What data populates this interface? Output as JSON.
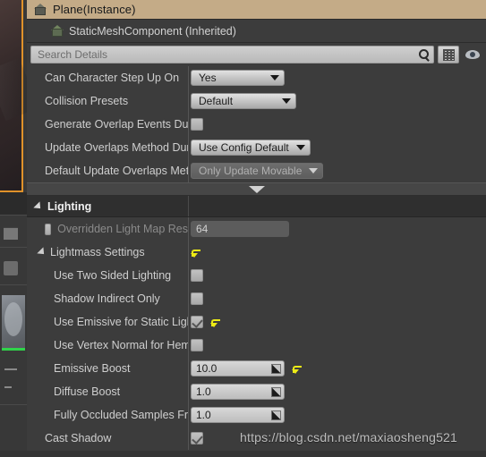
{
  "window": {
    "actor_title": "Plane(Instance)",
    "actor_icon": "house-icon",
    "component_title": "StaticMeshComponent (Inherited)",
    "component_icon": "house-icon"
  },
  "search": {
    "placeholder": "Search Details",
    "search_icon": "magnifier-icon",
    "grid_button_icon": "grid-view-icon",
    "eye_button_icon": "eye-icon"
  },
  "collision_rows": [
    {
      "label": "Can Character Step Up On",
      "type": "combo",
      "value": "Yes",
      "disabled": false,
      "reset": false
    },
    {
      "label": "Collision Presets",
      "type": "combo",
      "value": "Default",
      "disabled": false,
      "reset": false
    },
    {
      "label": "Generate Overlap Events During L",
      "type": "checkbox",
      "value": "unchecked",
      "disabled": false,
      "reset": false
    },
    {
      "label": "Update Overlaps Method During L",
      "type": "combo",
      "value": "Use Config Default",
      "disabled": false,
      "reset": false
    },
    {
      "label": "Default Update Overlaps Method",
      "type": "combo",
      "value": "Only Update Movable",
      "disabled": true,
      "reset": false
    }
  ],
  "expander": {
    "icon": "chevron-down-icon"
  },
  "lighting": {
    "category_label": "Lighting",
    "rows": [
      {
        "label": "Overridden Light Map Res",
        "type": "checkbox-field",
        "checkbox": "unchecked",
        "value": "64",
        "disabled": true,
        "reset": false
      },
      {
        "label": "Lightmass Settings",
        "type": "group",
        "value": "",
        "disabled": false,
        "reset": true
      },
      {
        "label": "Use Two Sided Lighting",
        "type": "checkbox",
        "value": "unchecked",
        "disabled": false,
        "reset": false
      },
      {
        "label": "Shadow Indirect Only",
        "type": "checkbox",
        "value": "unchecked",
        "disabled": false,
        "reset": false
      },
      {
        "label": "Use Emissive for Static Lightin",
        "type": "checkbox",
        "value": "checked",
        "disabled": false,
        "reset": true
      },
      {
        "label": "Use Vertex Normal for Hemispl",
        "type": "checkbox",
        "value": "unchecked",
        "disabled": false,
        "reset": false
      },
      {
        "label": "Emissive Boost",
        "type": "number",
        "value": "10.0",
        "disabled": false,
        "reset": true
      },
      {
        "label": "Diffuse Boost",
        "type": "number",
        "value": "1.0",
        "disabled": false,
        "reset": false
      },
      {
        "label": "Fully Occluded Samples Fractio",
        "type": "number",
        "value": "1.0",
        "disabled": false,
        "reset": false
      },
      {
        "label": "Cast Shadow",
        "type": "checkbox",
        "value": "checked",
        "disabled": false,
        "reset": false
      }
    ]
  },
  "watermark": {
    "text": "https://blog.csdn.net/maxiaosheng521"
  },
  "colors": {
    "header_tan": "#c4ab87",
    "panel_bg": "#3c3c3c",
    "category_bg": "#2f2f2f",
    "reset_yellow": "#ecea16",
    "selection_orange": "#e0922a"
  }
}
